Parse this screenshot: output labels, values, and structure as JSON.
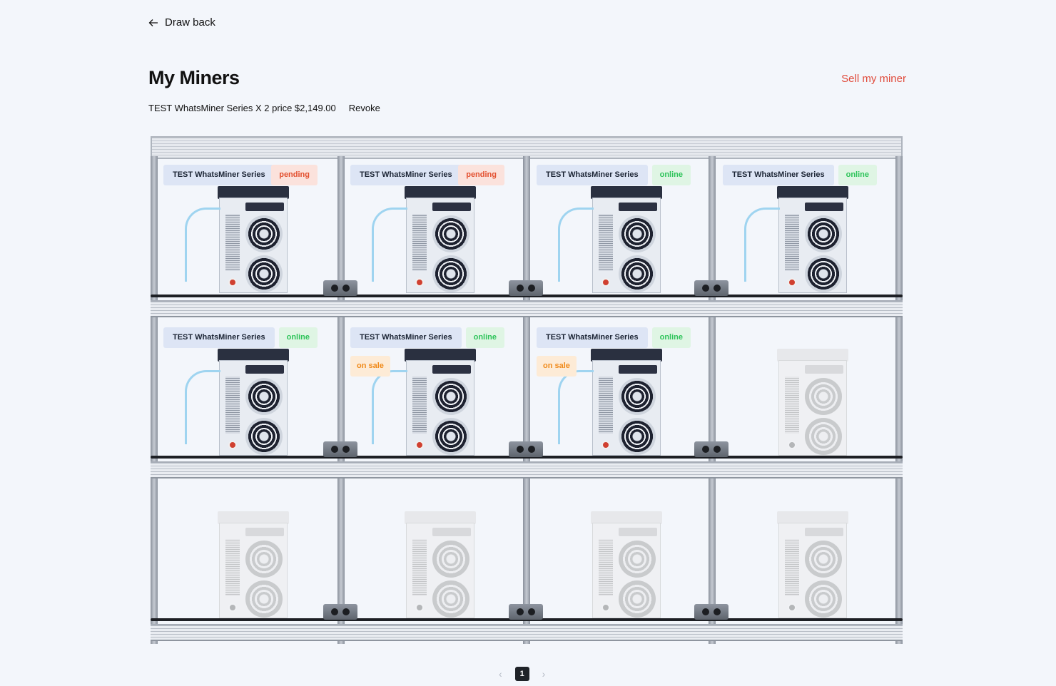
{
  "nav": {
    "back_label": "Draw back"
  },
  "header": {
    "title": "My Miners",
    "sell_label": "Sell my miner"
  },
  "listing": {
    "text": "TEST WhatsMiner Series X 2 price $2,149.00",
    "revoke_label": "Revoke"
  },
  "slots": [
    {
      "name": "TEST WhatsMiner Series",
      "status": "pending",
      "sale": ""
    },
    {
      "name": "TEST WhatsMiner Series",
      "status": "pending",
      "sale": ""
    },
    {
      "name": "TEST WhatsMiner Series",
      "status": "online",
      "sale": ""
    },
    {
      "name": "TEST WhatsMiner Series",
      "status": "online",
      "sale": ""
    },
    {
      "name": "TEST WhatsMiner Series",
      "status": "online",
      "sale": ""
    },
    {
      "name": "TEST WhatsMiner Series",
      "status": "online",
      "sale": "on sale"
    },
    {
      "name": "TEST WhatsMiner Series",
      "status": "online",
      "sale": "on sale"
    },
    {
      "name": "",
      "status": "",
      "sale": ""
    },
    {
      "name": "",
      "status": "",
      "sale": ""
    },
    {
      "name": "",
      "status": "",
      "sale": ""
    },
    {
      "name": "",
      "status": "",
      "sale": ""
    },
    {
      "name": "",
      "status": "",
      "sale": ""
    }
  ],
  "pagination": {
    "current": "1",
    "prev_icon": "chevron-left-icon",
    "next_icon": "chevron-right-icon"
  },
  "colors": {
    "accent": "#e04a3a",
    "pending": "#e3502f",
    "online": "#2ec45a",
    "on_sale": "#f08a1a"
  }
}
